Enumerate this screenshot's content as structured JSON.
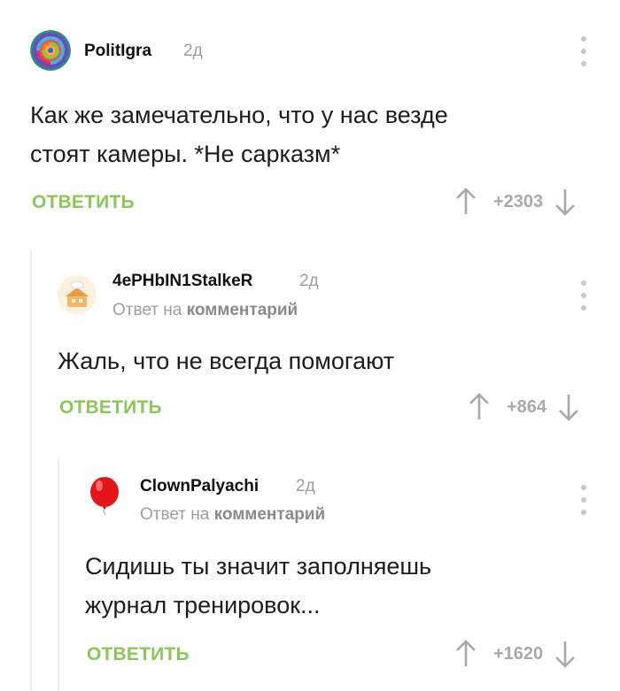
{
  "comments": [
    {
      "author": "PolitIgra",
      "time": "2д",
      "text_lines": [
        "Как же замечательно, что у нас везде",
        "стоят камеры. *Не сарказм*"
      ],
      "reply_label": "ОТВЕТИТЬ",
      "rating": "+2303",
      "avatar_icon": "rainbow-swirl-avatar"
    },
    {
      "author": "4ePHbIN1StalkeR",
      "time": "2д",
      "reply_to_prefix": "Ответ на",
      "reply_to_target": "комментарий",
      "text_lines": [
        "Жаль, что не всегда помогают"
      ],
      "reply_label": "ОТВЕТИТЬ",
      "rating": "+864",
      "avatar_icon": "chef-house-avatar"
    },
    {
      "author": "ClownPalyachi",
      "time": "2д",
      "reply_to_prefix": "Ответ на",
      "reply_to_target": "комментарий",
      "text_lines": [
        "Сидишь ты значит заполняешь",
        "журнал тренировок..."
      ],
      "reply_label": "ОТВЕТИТЬ",
      "rating": "+1620",
      "avatar_icon": "red-balloon-avatar"
    }
  ],
  "colors": {
    "accent_green": "#8ac858",
    "meta_gray": "#9e9e9e",
    "thread_line": "#eeeeee"
  }
}
